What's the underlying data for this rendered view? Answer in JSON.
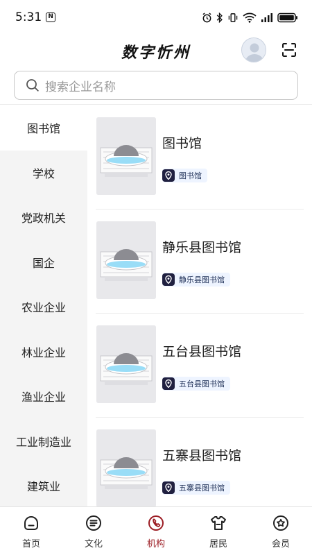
{
  "status_bar": {
    "time": "5:31",
    "nfc_glyph": "N",
    "icons": [
      "alarm-icon",
      "bluetooth-icon",
      "vibrate-icon",
      "wifi-icon",
      "signal-icon",
      "battery-icon"
    ]
  },
  "header": {
    "title": "数字忻州"
  },
  "search": {
    "placeholder": "搜索企业名称"
  },
  "sidebar": {
    "items": [
      {
        "label": "图书馆",
        "active": true
      },
      {
        "label": "学校"
      },
      {
        "label": "党政机关"
      },
      {
        "label": "国企"
      },
      {
        "label": "农业企业"
      },
      {
        "label": "林业企业"
      },
      {
        "label": "渔业企业"
      },
      {
        "label": "工业制造业"
      },
      {
        "label": "建筑业"
      }
    ]
  },
  "list": {
    "items": [
      {
        "title": "图书馆",
        "tag": "图书馆"
      },
      {
        "title": "静乐县图书馆",
        "tag": "静乐县图书馆"
      },
      {
        "title": "五台县图书馆",
        "tag": "五台县图书馆"
      },
      {
        "title": "五寨县图书馆",
        "tag": "五寨县图书馆"
      }
    ]
  },
  "bottom_nav": {
    "items": [
      {
        "label": "首页",
        "icon": "home-icon"
      },
      {
        "label": "文化",
        "icon": "culture-icon"
      },
      {
        "label": "机构",
        "icon": "institution-icon",
        "active": true
      },
      {
        "label": "居民",
        "icon": "resident-icon"
      },
      {
        "label": "会员",
        "icon": "member-icon"
      }
    ]
  },
  "colors": {
    "accent": "#9c1d24",
    "tag_bg": "#eef4ff",
    "tag_icon_bg": "#202040",
    "sidebar_bg": "#f4f4f4"
  }
}
